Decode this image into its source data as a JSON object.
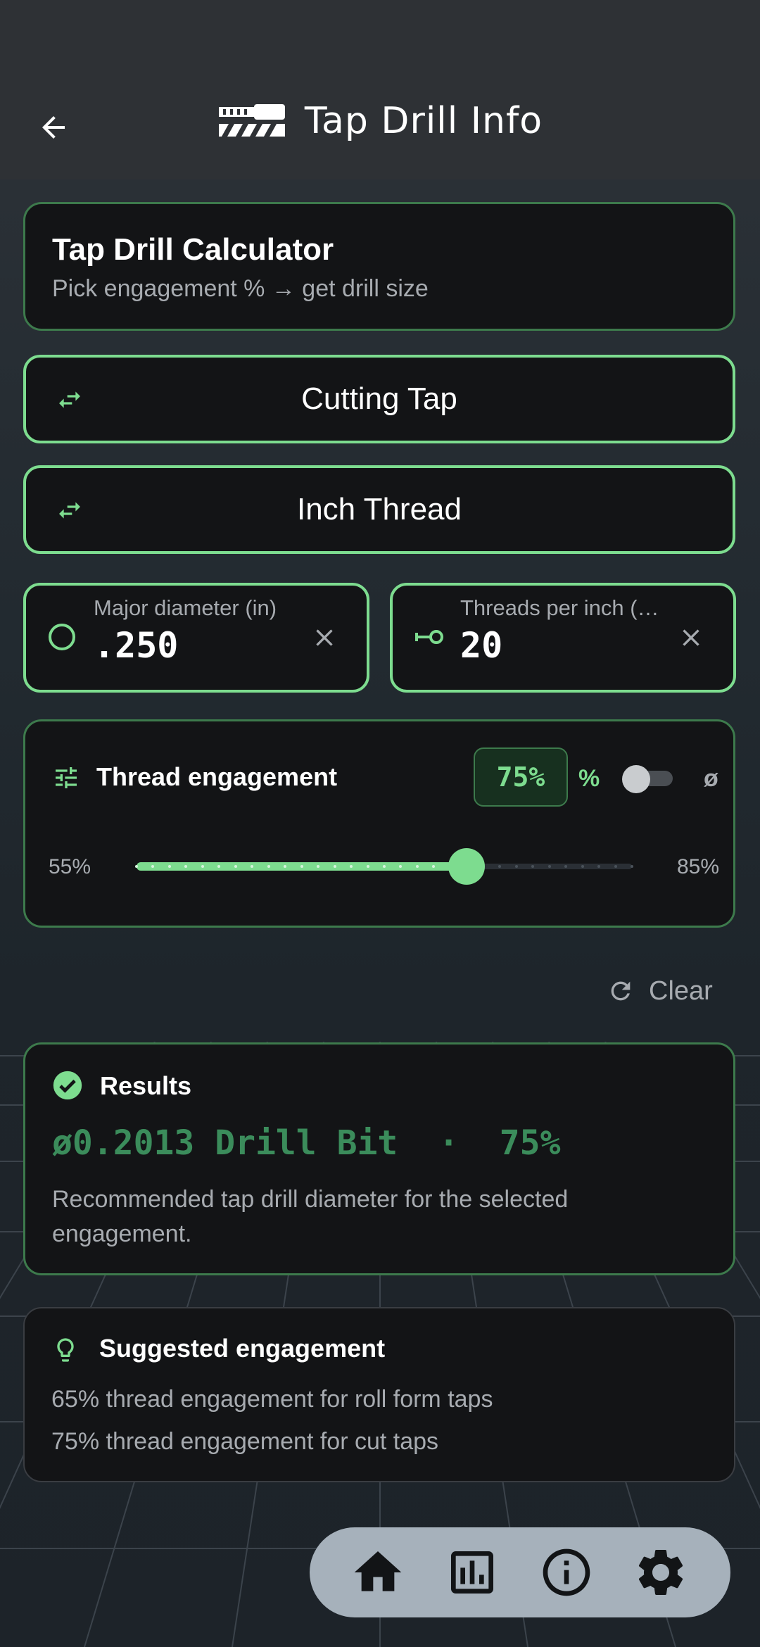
{
  "app_bar": {
    "title": "Tap Drill Info"
  },
  "intro": {
    "title": "Tap Drill Calculator",
    "subtitle": "Pick engagement % → get drill size"
  },
  "selectors": {
    "tap_type": "Cutting Tap",
    "thread_type": "Inch Thread"
  },
  "inputs": {
    "major_diameter": {
      "label": "Major diameter (in)",
      "value": ".250"
    },
    "tpi": {
      "label": "Threads per inch (…",
      "value": "20"
    }
  },
  "engagement": {
    "title": "Thread engagement",
    "chip_value": "75%",
    "percent_symbol": "%",
    "diameter_symbol": "ø",
    "toggle_on": false,
    "slider": {
      "min_label": "55%",
      "max_label": "85%",
      "min": 55,
      "max": 85,
      "value": 75,
      "step": 1
    }
  },
  "clear_label": "Clear",
  "results": {
    "title": "Results",
    "value": "ø0.2013 Drill Bit  ·  75%",
    "description": "Recommended tap drill diameter for the selected engagement."
  },
  "suggested": {
    "title": "Suggested engagement",
    "lines": [
      "65% thread engagement for roll form taps",
      "75% thread engagement for cut taps"
    ]
  },
  "bottom_nav": {
    "items": [
      "home-icon",
      "chart-icon",
      "info-icon",
      "settings-icon"
    ]
  },
  "colors": {
    "accent": "#7ddc8f",
    "card_border": "#3d7a4c",
    "card_bg": "#131416",
    "result_text": "#3b8c5b",
    "background": "#2e3135"
  }
}
